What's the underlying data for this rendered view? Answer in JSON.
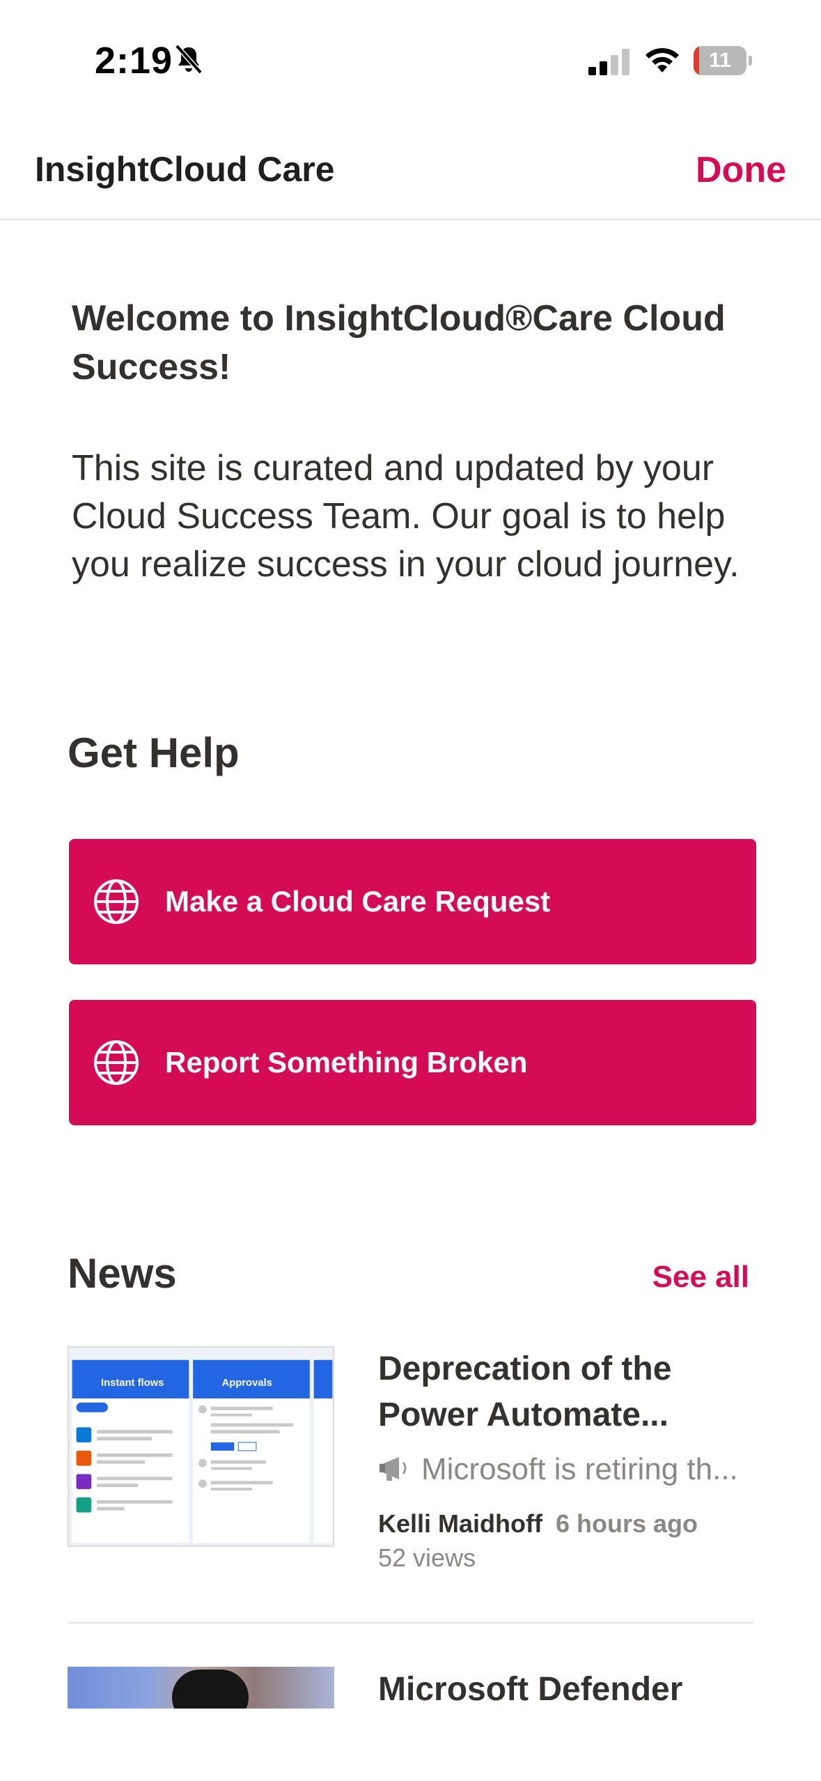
{
  "status_bar": {
    "time": "2:19",
    "battery": "11"
  },
  "nav": {
    "title": "InsightCloud Care",
    "done_label": "Done"
  },
  "intro": {
    "welcome": "Welcome to InsightCloud®Care Cloud Success!",
    "body": "This site is curated and updated by your Cloud Success Team.  Our goal is to help you realize success in your cloud journey."
  },
  "get_help": {
    "title": "Get Help",
    "buttons": [
      {
        "label": "Make a Cloud Care Request",
        "icon": "globe-icon"
      },
      {
        "label": "Report Something Broken",
        "icon": "globe-icon"
      }
    ]
  },
  "news": {
    "title": "News",
    "see_all_label": "See all",
    "items": [
      {
        "headline": "Deprecation of the Power Automate...",
        "description": "Microsoft is retiring th...",
        "description_icon": "megaphone-icon",
        "author": "Kelli Maidhoff",
        "time": "6 hours ago",
        "views": "52 views"
      },
      {
        "headline": "Microsoft Defender"
      }
    ]
  },
  "thumbnail_1": {
    "panel_left_title": "Instant flows",
    "panel_right_title": "Approvals"
  },
  "colors": {
    "accent": "#d40c55",
    "text": "#323130",
    "muted": "#8a8886"
  }
}
